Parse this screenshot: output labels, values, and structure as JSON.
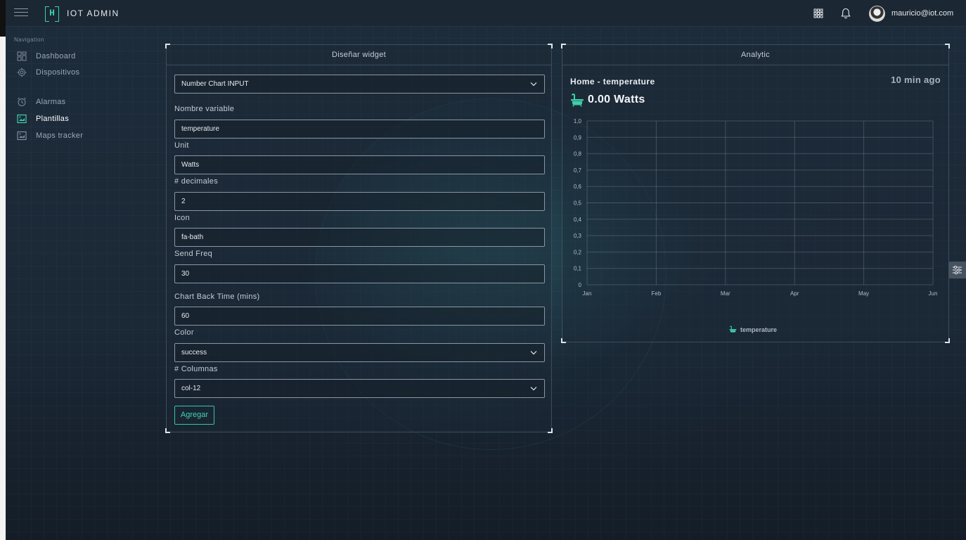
{
  "app": {
    "brand": "IOT ADMIN",
    "logo_letter": "H"
  },
  "topbar": {
    "user_email": "mauricio@iot.com"
  },
  "sidebar": {
    "section_title": "Navigation",
    "items": [
      {
        "label": "Dashboard",
        "icon": "dashboard-icon"
      },
      {
        "label": "Dispositivos",
        "icon": "gear-icon"
      },
      {
        "label": "Alarmas",
        "icon": "alarm-clock-icon"
      },
      {
        "label": "Plantillas",
        "icon": "template-icon",
        "active": true
      },
      {
        "label": "Maps tracker",
        "icon": "map-icon"
      }
    ]
  },
  "form": {
    "title": "Diseñar widget",
    "widget_type": "Number Chart INPUT",
    "fields": {
      "variable": {
        "label": "Nombre variable",
        "value": "temperature"
      },
      "unit": {
        "label": "Unit",
        "value": "Watts"
      },
      "decimals": {
        "label": "# decimales",
        "value": "2"
      },
      "icon": {
        "label": "Icon",
        "value": "fa-bath"
      },
      "send_freq": {
        "label": "Send Freq",
        "value": "30"
      },
      "back_time": {
        "label": "Chart Back Time (mins)",
        "value": "60"
      },
      "color": {
        "label": "Color",
        "value": "success"
      },
      "columns": {
        "label": "# Columnas",
        "value": "col-12"
      }
    },
    "submit_label": "Agregar"
  },
  "preview": {
    "title": "Analytic",
    "widget_title": "Home - temperature",
    "time_ago": "10 min ago",
    "value_text": "0.00 Watts",
    "accent_color": "#3ecfa9"
  },
  "chart_data": {
    "type": "line",
    "categories": [
      "Jan",
      "Feb",
      "Mar",
      "Apr",
      "May",
      "Jun"
    ],
    "series": [
      {
        "name": "temperature",
        "values": []
      }
    ],
    "ylim": [
      0,
      1
    ],
    "yticks": [
      "0",
      "0,1",
      "0,2",
      "0,3",
      "0,4",
      "0,5",
      "0,6",
      "0,7",
      "0,8",
      "0,9",
      "1,0"
    ],
    "grid": true,
    "legend": "bottom"
  }
}
